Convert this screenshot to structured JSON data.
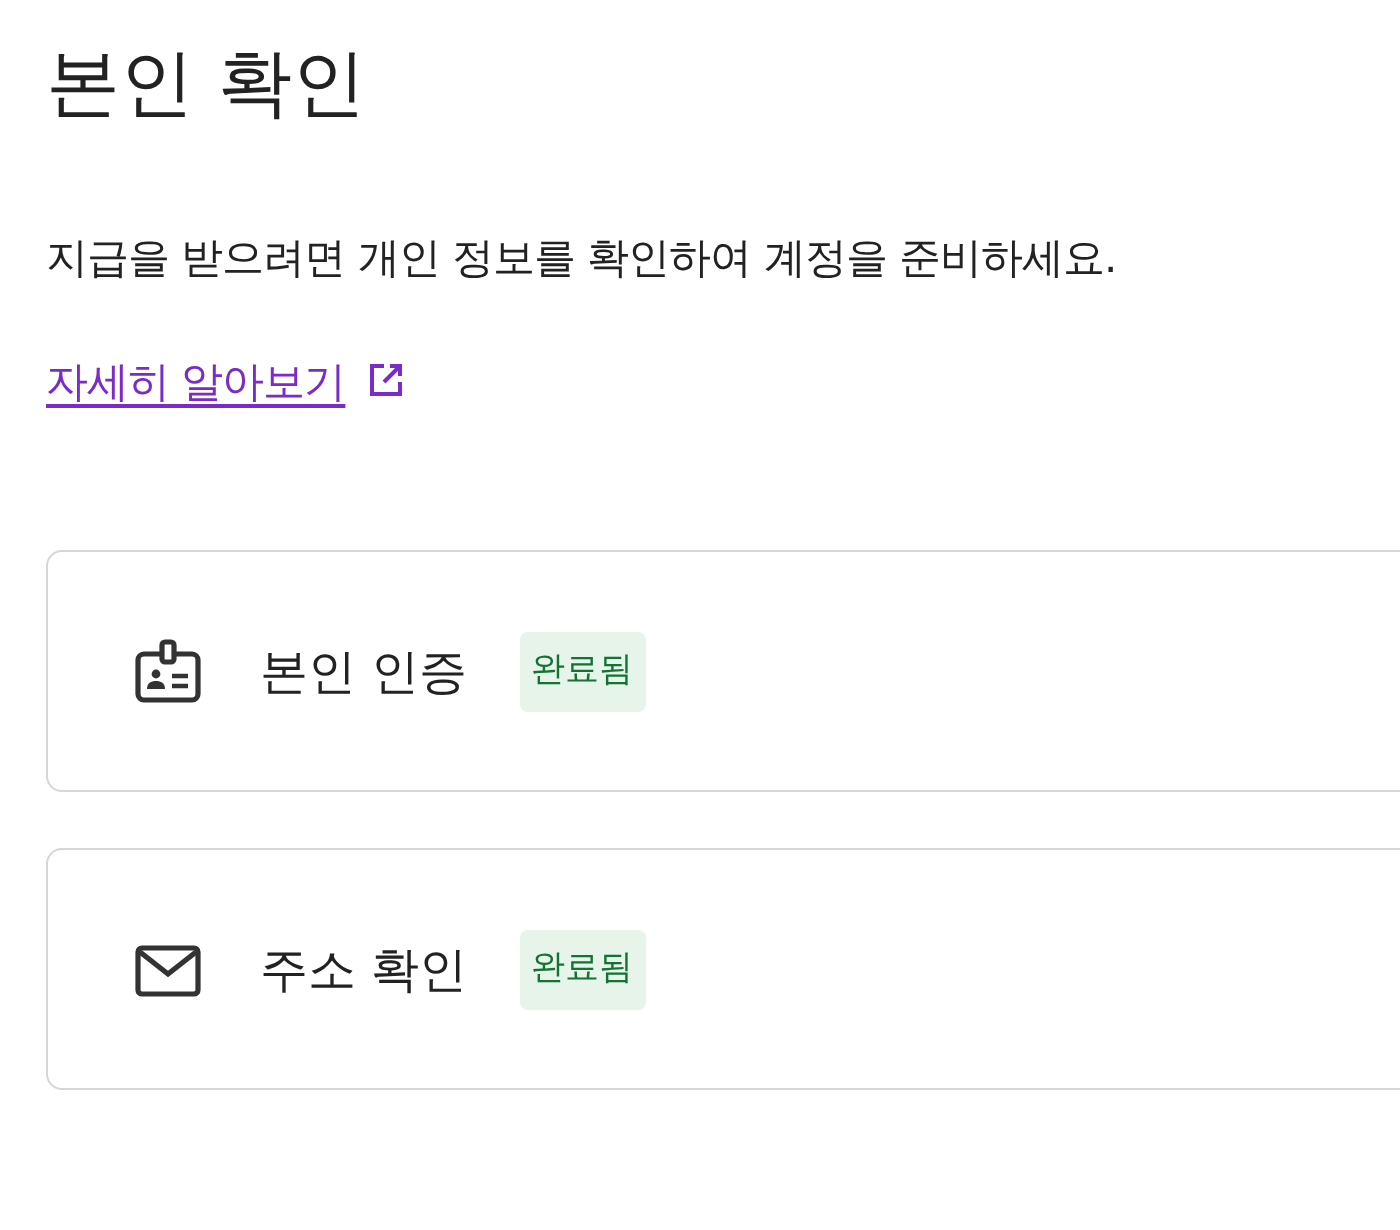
{
  "title": "본인 확인",
  "description": "지급을 받으려면 개인 정보를 확인하여 계정을 준비하세요.",
  "link": {
    "label": "자세히 알아보기"
  },
  "steps": [
    {
      "kind": "id-card",
      "label": "본인 인증",
      "status": "완료됨"
    },
    {
      "kind": "mail",
      "label": "주소 확인",
      "status": "완료됨"
    }
  ]
}
